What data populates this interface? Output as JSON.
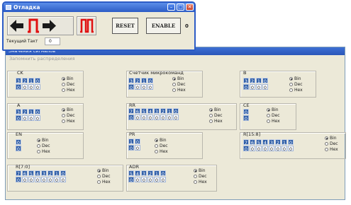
{
  "debug_window": {
    "title": "Отладка",
    "reset_label": "RESET",
    "enable_label": "ENABLE",
    "enable_value": "0",
    "tact_label": "Текущий Такт",
    "tact_value": "0"
  },
  "main_window": {
    "title": "Значения сигналов",
    "menu_item": "Запомнить распределения"
  },
  "radio_labels": [
    "Bin",
    "Dec",
    "Hex"
  ],
  "registers": [
    {
      "name": "CK",
      "headers": [
        "3",
        "2",
        "1",
        "0"
      ],
      "values": [
        "0",
        "0",
        "0",
        "0"
      ],
      "mode": "Bin"
    },
    {
      "name": "Счетчик микрокоманд",
      "headers": [
        "3",
        "2",
        "1",
        "0"
      ],
      "values": [
        "0",
        "0",
        "0",
        "0"
      ],
      "mode": "Bin"
    },
    {
      "name": "B",
      "headers": [
        "3",
        "2",
        "1",
        "0"
      ],
      "values": [
        "0",
        "0",
        "0",
        "0"
      ],
      "mode": "Bin"
    },
    {
      "name": "A",
      "headers": [
        "3",
        "2",
        "1",
        "0"
      ],
      "values": [
        "0",
        "0",
        "0",
        "0"
      ],
      "mode": "Bin"
    },
    {
      "name": "RR",
      "headers": [
        "7",
        "6",
        "5",
        "4",
        "3",
        "2",
        "1",
        "0"
      ],
      "values": [
        "0",
        "0",
        "0",
        "0",
        "0",
        "0",
        "0",
        "0"
      ],
      "mode": "Bin"
    },
    {
      "name": "CE",
      "headers": [
        "0"
      ],
      "values": [
        "0"
      ],
      "mode": "Bin"
    },
    {
      "name": "EN",
      "headers": [
        "0"
      ],
      "values": [
        "0"
      ],
      "mode": "Bin"
    },
    {
      "name": "PR",
      "headers": [
        "1",
        "0"
      ],
      "values": [
        "0",
        "0"
      ],
      "mode": "Bin"
    },
    {
      "name": "R[15:8]",
      "headers": [
        "7",
        "6",
        "5",
        "4",
        "3",
        "2",
        "1",
        "0"
      ],
      "values": [
        "0",
        "0",
        "0",
        "0",
        "0",
        "0",
        "0",
        "0"
      ],
      "mode": "Bin"
    },
    {
      "name": "R[7:0]",
      "headers": [
        "7",
        "6",
        "5",
        "4",
        "3",
        "2",
        "1",
        "0"
      ],
      "values": [
        "0",
        "0",
        "0",
        "0",
        "0",
        "0",
        "0",
        "0"
      ],
      "mode": "Bin"
    },
    {
      "name": "ADR",
      "headers": [
        "5",
        "4",
        "3",
        "2",
        "1",
        "0"
      ],
      "values": [
        "0",
        "0",
        "0",
        "0",
        "0",
        "0"
      ],
      "mode": "Bin"
    }
  ]
}
